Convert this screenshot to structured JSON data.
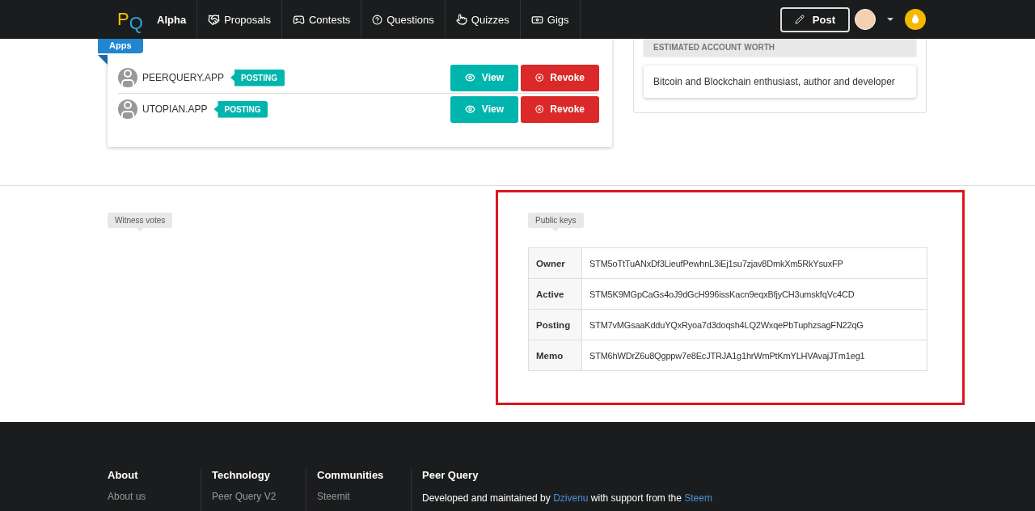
{
  "nav": {
    "logo": {
      "p": "P",
      "q": "Q"
    },
    "brand": "Alpha",
    "items": [
      {
        "kind": "handshake",
        "label": "Proposals"
      },
      {
        "kind": "gamepad",
        "label": "Contests"
      },
      {
        "kind": "question",
        "label": "Questions"
      },
      {
        "kind": "pointer",
        "label": "Quizzes"
      },
      {
        "kind": "money",
        "label": "Gigs"
      }
    ],
    "post": "Post"
  },
  "apps": {
    "ribbon": "Apps",
    "rows": [
      {
        "name": "PEERQUERY.APP",
        "tag": "POSTING",
        "view": "View",
        "revoke": "Revoke"
      },
      {
        "name": "UTOPIAN.APP",
        "tag": "POSTING",
        "view": "View",
        "revoke": "Revoke"
      }
    ]
  },
  "profile": {
    "worth_label": "ESTIMATED ACCOUNT WORTH",
    "bio": "Bitcoin and Blockchain enthusiast, author and developer"
  },
  "witness": {
    "label": "Witness votes"
  },
  "public_keys": {
    "label": "Public keys",
    "highlighted": true,
    "rows": [
      {
        "name": "Owner",
        "key": "STM5oTtTuANxDf3LieufPewhnL3iEj1su7zjav8DmkXm5RkYsuxFP"
      },
      {
        "name": "Active",
        "key": "STM5K9MGpCaGs4oJ9dGcH996issKacn9eqxBfjyCH3umskfqVc4CD"
      },
      {
        "name": "Posting",
        "key": "STM7vMGsaaKdduYQxRyoa7d3doqsh4LQ2WxqePbTuphzsagFN22qG"
      },
      {
        "name": "Memo",
        "key": "STM6hWDrZ6u8Qgppw7e8EcJTRJA1g1hrWmPtKmYLHVAvajJTm1eg1"
      }
    ]
  },
  "footer": {
    "columns": [
      {
        "title": "About",
        "link": "About us"
      },
      {
        "title": "Technology",
        "link": "Peer Query V2"
      },
      {
        "title": "Communities",
        "link": "Steemit"
      }
    ],
    "about": {
      "title": "Peer Query",
      "before": "Developed and maintained by ",
      "link1": "Dzivenu",
      "middle": " with support from the ",
      "link2": "Steem"
    }
  }
}
